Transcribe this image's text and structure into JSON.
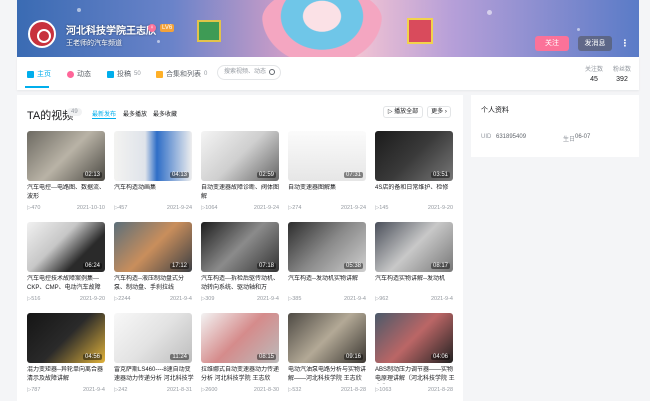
{
  "header": {
    "username": "河北科技学院王志欣",
    "gender_symbol": "♀",
    "level": "LV6",
    "sign": "王老师的汽车频道",
    "follow_label": "关注",
    "message_label": "发消息",
    "more_label": "⋮"
  },
  "nav": {
    "items": [
      {
        "label": "主页",
        "count": ""
      },
      {
        "label": "动态",
        "count": ""
      },
      {
        "label": "投稿",
        "count": "50"
      },
      {
        "label": "合集和列表",
        "count": "0"
      }
    ],
    "search_placeholder": "搜索视频、动态"
  },
  "stats": [
    {
      "label": "关注数",
      "value": "45"
    },
    {
      "label": "粉丝数",
      "value": "392"
    }
  ],
  "videos_section": {
    "title": "TA的视频",
    "count": "49",
    "sort_tabs": [
      "最新发布",
      "最多播放",
      "最多收藏"
    ],
    "play_all_label": "▷ 播放全部",
    "more_label": "更多 ›"
  },
  "videos": [
    {
      "title": "汽车电控---电路图、数据流、波形",
      "duration": "02:13",
      "plays": "470",
      "date": "2021-10-10"
    },
    {
      "title": "汽车构造动画集",
      "duration": "04:13",
      "plays": "457",
      "date": "2021-9-24"
    },
    {
      "title": "自动变速器故障诊断、阀体图解",
      "duration": "02:59",
      "plays": "1064",
      "date": "2021-9-24"
    },
    {
      "title": "自动变速器图解集",
      "duration": "07:31",
      "plays": "274",
      "date": "2021-9-24"
    },
    {
      "title": "4S店的备和日常维护、检修",
      "duration": "03:51",
      "plays": "145",
      "date": "2021-9-20"
    },
    {
      "title": "汽车电控技术故障案例集---CKP、CMP、电动汽车故障",
      "duration": "06:24",
      "plays": "516",
      "date": "2021-9-20"
    },
    {
      "title": "汽车构造--液压制动盘式分泵、制动盘、手刹拉线",
      "duration": "17:12",
      "plays": "2244",
      "date": "2021-9-4"
    },
    {
      "title": "汽车构造---拆检后驱传动机、动转向系统、驱动轴和万",
      "duration": "07:18",
      "plays": "309",
      "date": "2021-9-4"
    },
    {
      "title": "汽车构造--发动机实物讲解",
      "duration": "05:38",
      "plays": "385",
      "date": "2021-9-4"
    },
    {
      "title": "汽车构造实物讲解--发动机",
      "duration": "08:17",
      "plays": "962",
      "date": "2021-9-4"
    },
    {
      "title": "混力变矩器--异轮单向离合器清示及故障讲解",
      "duration": "04:56",
      "plays": "787",
      "date": "2021-9-4"
    },
    {
      "title": "雷克萨斯LS460----8速自动变速器动力传递分析 河北科技学",
      "duration": "11:24",
      "plays": "242",
      "date": "2021-8-31"
    },
    {
      "title": "拉维娜式自动变速器动力传递分析 河北科技学院 王志欣",
      "duration": "08:15",
      "plays": "2600",
      "date": "2021-8-30"
    },
    {
      "title": "电动汽油泵电路分析与实物讲解——河北科技学院 王志欣",
      "duration": "09:16",
      "plays": "532",
      "date": "2021-8-28"
    },
    {
      "title": "ABS制动压力调节器——实物电原理讲解（河北科技学院 王志欣",
      "duration": "04:06",
      "plays": "1063",
      "date": "2021-8-28"
    }
  ],
  "profile": {
    "title": "个人资料",
    "uid_label": "UID",
    "uid": "631895409",
    "birthday_label": "生日",
    "birthday": "06-07"
  },
  "colors": {
    "accent": "#00aeec",
    "pink": "#fb7299"
  }
}
